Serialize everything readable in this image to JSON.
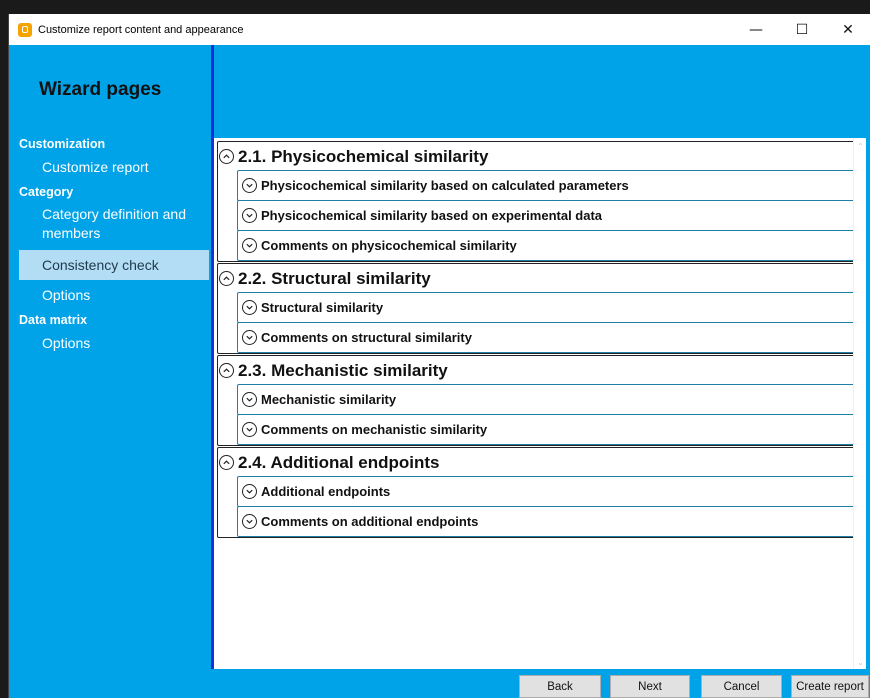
{
  "window": {
    "title": "Customize report content and appearance",
    "controls": {
      "minimize": "—",
      "maximize": "☐",
      "close": "✕"
    }
  },
  "sidebar": {
    "heading": "Wizard pages",
    "groups": [
      {
        "label": "Customization",
        "items": [
          {
            "label": "Customize report"
          }
        ]
      },
      {
        "label": "Category",
        "items": [
          {
            "label": "Category definition and members"
          },
          {
            "label": "Consistency check",
            "selected": true
          },
          {
            "label": "Options"
          }
        ]
      },
      {
        "label": "Data matrix",
        "items": [
          {
            "label": "Options"
          }
        ]
      }
    ]
  },
  "sections": [
    {
      "title": "2.1. Physicochemical similarity",
      "items": [
        "Physicochemical similarity based on calculated parameters",
        "Physicochemical similarity based on experimental data",
        "Comments on physicochemical similarity"
      ]
    },
    {
      "title": "2.2. Structural similarity",
      "items": [
        "Structural similarity",
        "Comments on structural similarity"
      ]
    },
    {
      "title": "2.3. Mechanistic similarity",
      "items": [
        "Mechanistic similarity",
        "Comments on mechanistic similarity"
      ]
    },
    {
      "title": "2.4. Additional endpoints",
      "items": [
        "Additional endpoints",
        "Comments on additional endpoints"
      ]
    }
  ],
  "footer": {
    "back": "Back",
    "next": "Next",
    "cancel": "Cancel",
    "create": "Create report"
  },
  "colors": {
    "accent": "#00a2e8",
    "selected": "#b3dcf5",
    "divider": "#1530d8"
  }
}
